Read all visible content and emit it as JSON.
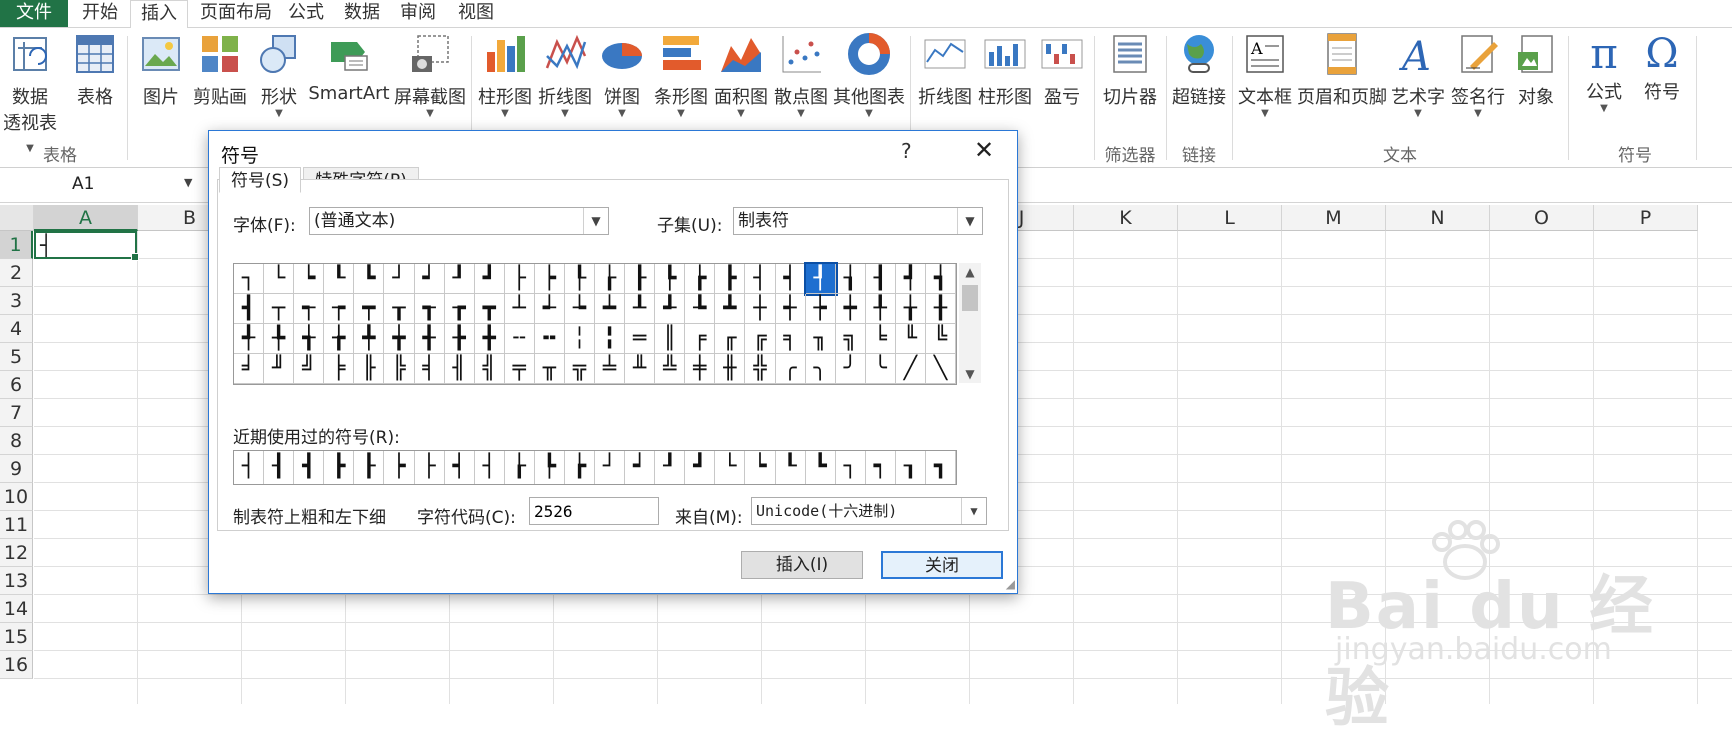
{
  "tabs": [
    "文件",
    "开始",
    "插入",
    "页面布局",
    "公式",
    "数据",
    "审阅",
    "视图"
  ],
  "active_tab": "插入",
  "ribbon": {
    "groups": [
      "表格",
      "筛选器",
      "链接",
      "文本",
      "符号"
    ],
    "hidden_group_fragment": "图",
    "buttons": {
      "pivot": [
        "数据",
        "透视表"
      ],
      "table": "表格",
      "picture": "图片",
      "clipart": "剪贴画",
      "shapes": "形状",
      "smartart": "SmartArt",
      "screenshot": "屏幕截图",
      "column_chart": "柱形图",
      "line_chart": "折线图",
      "pie_chart": "饼图",
      "bar_chart": "条形图",
      "area_chart": "面积图",
      "scatter_chart": "散点图",
      "other_chart": "其他图表",
      "spark_line": "折线图",
      "spark_column": "柱形图",
      "spark_winloss": "盈亏",
      "slicer": "切片器",
      "hyperlink": "超链接",
      "textbox": "文本框",
      "header_footer": "页眉和页脚",
      "wordart": "艺术字",
      "signature": "签名行",
      "object": "对象",
      "equation": "公式",
      "symbol": "符号"
    }
  },
  "namebox": "A1",
  "columns": [
    "A",
    "B",
    "C",
    "D",
    "E",
    "F",
    "G",
    "H",
    "I",
    "J",
    "K",
    "L",
    "M",
    "N",
    "O",
    "P"
  ],
  "rows": [
    "1",
    "2",
    "3",
    "4",
    "5",
    "6",
    "7",
    "8",
    "9",
    "10",
    "11",
    "12",
    "13",
    "14",
    "15",
    "16"
  ],
  "cell_a1": "┤",
  "dialog": {
    "title": "符号",
    "help": "?",
    "close": "✕",
    "tab_symbols": "符号(S)",
    "tab_special": "特殊字符(P)",
    "font_label": "字体(F):",
    "font_value": "(普通文本)",
    "subset_label": "子集(U):",
    "subset_value": "制表符",
    "symbols": [
      "┐",
      "└",
      "┕",
      "┖",
      "┗",
      "┘",
      "┙",
      "┚",
      "┛",
      "├",
      "┝",
      "┞",
      "┟",
      "┠",
      "┡",
      "┢",
      "┣",
      "┤",
      "┥",
      "┦",
      "┧",
      "┨",
      "┩",
      "┪",
      "┫",
      "┬",
      "┭",
      "┮",
      "┯",
      "┰",
      "┱",
      "┲",
      "┳",
      "┴",
      "┵",
      "┶",
      "┷",
      "┸",
      "┹",
      "┺",
      "┻",
      "┼",
      "┽",
      "┾",
      "┿",
      "╀",
      "╁",
      "╂",
      "╃",
      "╄",
      "╅",
      "╆",
      "╇",
      "╈",
      "╉",
      "╊",
      "╋",
      "╌",
      "╍",
      "╎",
      "╏",
      "═",
      "║",
      "╒",
      "╓",
      "╔",
      "╕",
      "╖",
      "╗",
      "╘",
      "╙",
      "╚",
      "╛",
      "╜",
      "╝",
      "╞",
      "╟",
      "╠",
      "╡",
      "╢",
      "╣",
      "╤",
      "╥",
      "╦",
      "╧",
      "╨",
      "╩",
      "╪",
      "╫",
      "╬",
      "╭",
      "╮",
      "╯",
      "╰",
      "╱",
      "╲"
    ],
    "selected_symbol": "┦",
    "recent_label": "近期使用过的符号(R):",
    "recent": [
      "┤",
      "┨",
      "┫",
      "┣",
      "┠",
      "┝",
      "├",
      "┥",
      "┤",
      "┟",
      "┡",
      "┢",
      "┘",
      "┙",
      "┚",
      "┛",
      "└",
      "┕",
      "┖",
      "┗",
      "┐",
      "┑",
      "┒",
      "┓"
    ],
    "char_name": "制表符上粗和左下细",
    "code_label": "字符代码(C):",
    "code_value": "2526",
    "from_label": "来自(M):",
    "from_value": "Unicode(十六进制)",
    "insert_button": "插入(I)",
    "close_button": "关闭"
  },
  "watermark": {
    "brand": "Bai du 经验",
    "url": "jingyan.baidu.com"
  },
  "colors": {
    "excel_green": "#217346",
    "dialog_accent": "#2b78d6",
    "highlight": "#1e6fd0"
  }
}
